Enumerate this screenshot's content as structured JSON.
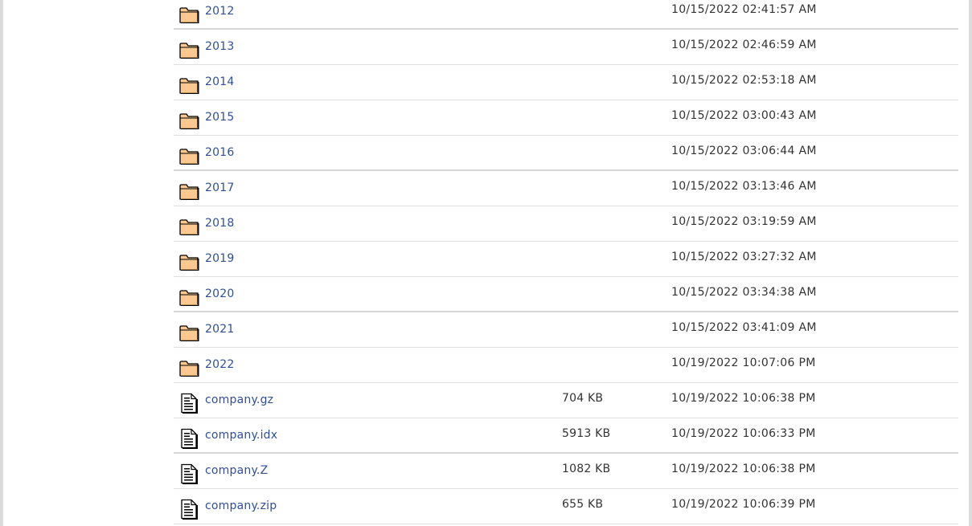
{
  "listing": {
    "rows": [
      {
        "name": "2012",
        "size": "",
        "date": "10/15/2022 02:41:57 AM",
        "icon": "folder-icon"
      },
      {
        "name": "2013",
        "size": "",
        "date": "10/15/2022 02:46:59 AM",
        "icon": "folder-icon"
      },
      {
        "name": "2014",
        "size": "",
        "date": "10/15/2022 02:53:18 AM",
        "icon": "folder-icon"
      },
      {
        "name": "2015",
        "size": "",
        "date": "10/15/2022 03:00:43 AM",
        "icon": "folder-icon"
      },
      {
        "name": "2016",
        "size": "",
        "date": "10/15/2022 03:06:44 AM",
        "icon": "folder-icon"
      },
      {
        "name": "2017",
        "size": "",
        "date": "10/15/2022 03:13:46 AM",
        "icon": "folder-icon"
      },
      {
        "name": "2018",
        "size": "",
        "date": "10/15/2022 03:19:59 AM",
        "icon": "folder-icon"
      },
      {
        "name": "2019",
        "size": "",
        "date": "10/15/2022 03:27:32 AM",
        "icon": "folder-icon"
      },
      {
        "name": "2020",
        "size": "",
        "date": "10/15/2022 03:34:38 AM",
        "icon": "folder-icon"
      },
      {
        "name": "2021",
        "size": "",
        "date": "10/15/2022 03:41:09 AM",
        "icon": "folder-icon"
      },
      {
        "name": "2022",
        "size": "",
        "date": "10/19/2022 10:07:06 PM",
        "icon": "folder-icon"
      },
      {
        "name": "company.gz",
        "size": "704 KB",
        "date": "10/19/2022 10:06:38 PM",
        "icon": "file-icon"
      },
      {
        "name": "company.idx",
        "size": "5913 KB",
        "date": "10/19/2022 10:06:33 PM",
        "icon": "file-icon"
      },
      {
        "name": "company.Z",
        "size": "1082 KB",
        "date": "10/19/2022 10:06:38 PM",
        "icon": "file-icon"
      },
      {
        "name": "company.zip",
        "size": "655 KB",
        "date": "10/19/2022 10:06:39 PM",
        "icon": "file-icon"
      }
    ]
  },
  "colors": {
    "link": "#2d4f9b",
    "text": "#333333",
    "folder_fill": "#fbc98f",
    "divider": "#dedede"
  }
}
